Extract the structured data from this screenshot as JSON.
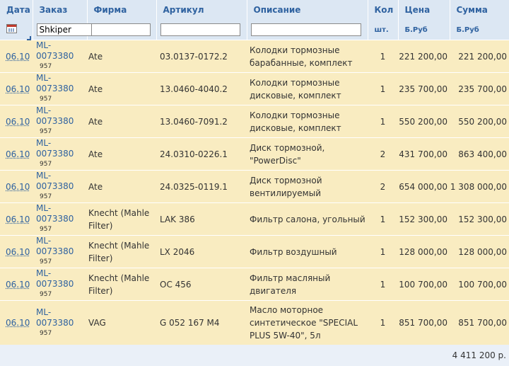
{
  "headers": {
    "date": "Дата",
    "order": "Заказ",
    "firm": "Фирма",
    "article": "Артикул",
    "desc": "Описание",
    "qty": "Кол",
    "price": "Цена",
    "sum": "Сумма"
  },
  "filters": {
    "order_value": "Shkiper",
    "firm_value": "",
    "article_value": "",
    "desc_value": "",
    "qty_unit": "шт.",
    "price_unit": "Б.Руб",
    "sum_unit": "Б.Руб"
  },
  "rows": [
    {
      "date": "06.10",
      "order": "ML-0073380",
      "sub": "957",
      "firm": "Ate",
      "article": "03.0137-0172.2",
      "desc": "Колодки тормозные барабанные, комплект",
      "qty": "1",
      "price": "221 200,00",
      "sum": "221 200,00"
    },
    {
      "date": "06.10",
      "order": "ML-0073380",
      "sub": "957",
      "firm": "Ate",
      "article": "13.0460-4040.2",
      "desc": "Колодки тормозные дисковые, комплект",
      "qty": "1",
      "price": "235 700,00",
      "sum": "235 700,00"
    },
    {
      "date": "06.10",
      "order": "ML-0073380",
      "sub": "957",
      "firm": "Ate",
      "article": "13.0460-7091.2",
      "desc": "Колодки тормозные дисковые, комплект",
      "qty": "1",
      "price": "550 200,00",
      "sum": "550 200,00"
    },
    {
      "date": "06.10",
      "order": "ML-0073380",
      "sub": "957",
      "firm": "Ate",
      "article": "24.0310-0226.1",
      "desc": "Диск тормозной, \"PowerDisc\"",
      "qty": "2",
      "price": "431 700,00",
      "sum": "863 400,00"
    },
    {
      "date": "06.10",
      "order": "ML-0073380",
      "sub": "957",
      "firm": "Ate",
      "article": "24.0325-0119.1",
      "desc": "Диск тормозной вентилируемый",
      "qty": "2",
      "price": "654 000,00",
      "sum": "1 308 000,00"
    },
    {
      "date": "06.10",
      "order": "ML-0073380",
      "sub": "957",
      "firm": "Knecht (Mahle Filter)",
      "article": "LAK 386",
      "desc": "Фильтр салона, угольный",
      "qty": "1",
      "price": "152 300,00",
      "sum": "152 300,00"
    },
    {
      "date": "06.10",
      "order": "ML-0073380",
      "sub": "957",
      "firm": "Knecht (Mahle Filter)",
      "article": "LX 2046",
      "desc": "Фильтр воздушный",
      "qty": "1",
      "price": "128 000,00",
      "sum": "128 000,00"
    },
    {
      "date": "06.10",
      "order": "ML-0073380",
      "sub": "957",
      "firm": "Knecht (Mahle Filter)",
      "article": "OC 456",
      "desc": "Фильтр масляный двигателя",
      "qty": "1",
      "price": "100 700,00",
      "sum": "100 700,00"
    },
    {
      "date": "06.10",
      "order": "ML-0073380",
      "sub": "957",
      "firm": "VAG",
      "article": "G 052 167 M4",
      "desc": "Масло моторное синтетическое \"SPECIAL PLUS 5W-40\", 5л",
      "qty": "1",
      "price": "851 700,00",
      "sum": "851 700,00"
    }
  ],
  "total": "4 411 200 р."
}
